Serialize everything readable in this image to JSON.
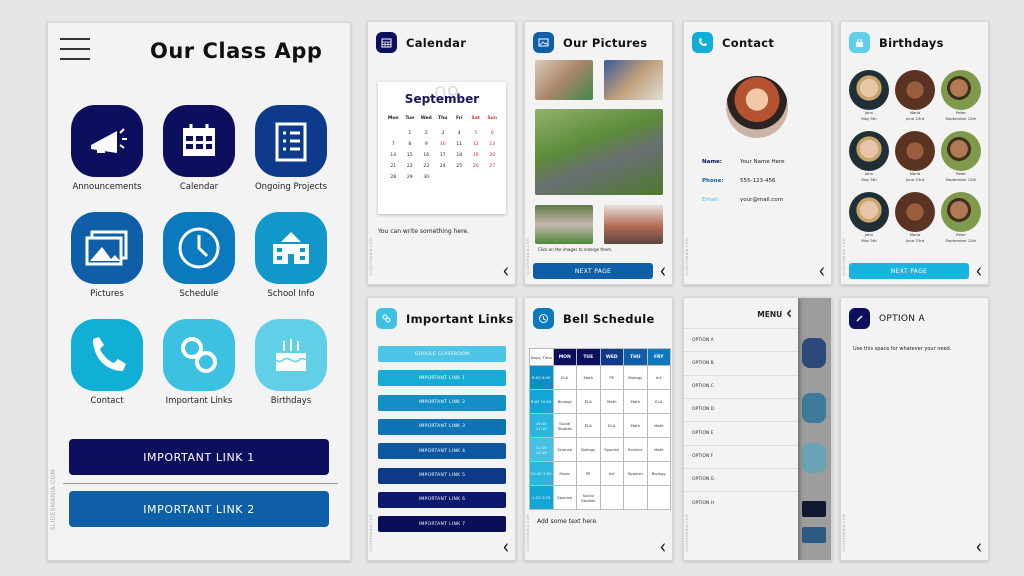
{
  "colors": {
    "navy": "#0c0e5e",
    "dark_blue": "#0d3a8a",
    "blue": "#0f5fa8",
    "mid_blue": "#0b79bd",
    "cyan": "#11aed6",
    "light_cyan": "#3cc1e2",
    "pale_cyan": "#62cfe8",
    "red": "#cc3333"
  },
  "watermark": "SLIDESMANIA.COM",
  "main": {
    "title": "Our Class App",
    "menu_icon": "hamburger-icon",
    "tiles": [
      {
        "label": "Announcements",
        "icon": "megaphone-icon",
        "color": "#0c0e5e"
      },
      {
        "label": "Calendar",
        "icon": "calendar-icon",
        "color": "#0c0e5e"
      },
      {
        "label": "Ongoing Projects",
        "icon": "clipboard-icon",
        "color": "#0d3a8a"
      },
      {
        "label": "Pictures",
        "icon": "pictures-icon",
        "color": "#0f5fa8"
      },
      {
        "label": "Schedule",
        "icon": "clock-icon",
        "color": "#0b79bd"
      },
      {
        "label": "School Info",
        "icon": "school-icon",
        "color": "#1297cb"
      },
      {
        "label": "Contact",
        "icon": "phone-icon",
        "color": "#11aed6"
      },
      {
        "label": "Important Links",
        "icon": "link-icon",
        "color": "#3cc1e2"
      },
      {
        "label": "Birthdays",
        "icon": "cake-icon",
        "color": "#62cfe8"
      }
    ],
    "buttons": [
      "IMPORTANT LINK 1",
      "IMPORTANT LINK 2"
    ]
  },
  "calendar": {
    "title": "Calendar",
    "month": "September",
    "month_number": "09",
    "weekdays": [
      "Mon",
      "Tue",
      "Wed",
      "Thu",
      "Fri",
      "Sat",
      "Sun"
    ],
    "weeks": [
      [
        "",
        "1",
        "2",
        "3",
        "4",
        "5",
        "6"
      ],
      [
        "7",
        "8",
        "9",
        "10",
        "11",
        "12",
        "13"
      ],
      [
        "14",
        "15",
        "16",
        "17",
        "18",
        "19",
        "20"
      ],
      [
        "21",
        "22",
        "23",
        "24",
        "25",
        "26",
        "27"
      ],
      [
        "28",
        "29",
        "30",
        "",
        "",
        "",
        ""
      ]
    ],
    "highlighted_days": [
      "10"
    ],
    "note": "You can write something here."
  },
  "pictures": {
    "title": "Our Pictures",
    "hint": "Click on the images to enlarge them.",
    "next": "NEXT PAGE"
  },
  "contact": {
    "title": "Contact",
    "fields": [
      {
        "label": "Name:",
        "value": "Your Name Here",
        "color": "#0c0e5e"
      },
      {
        "label": "Phone:",
        "value": "555-123-456",
        "color": "#0f5fa8"
      },
      {
        "label": "Email:",
        "value": "your@mail.com",
        "color": "#3cc1e2"
      }
    ]
  },
  "birthdays": {
    "title": "Birthdays",
    "next": "NEXT PAGE",
    "kids": [
      {
        "name": "John",
        "date": "May 5th"
      },
      {
        "name": "Maria",
        "date": "June 23rd"
      },
      {
        "name": "Peter",
        "date": "September 12th"
      },
      {
        "name": "John",
        "date": "May 5th"
      },
      {
        "name": "Maria",
        "date": "June 23rd"
      },
      {
        "name": "Peter",
        "date": "September 12th"
      },
      {
        "name": "John",
        "date": "May 5th"
      },
      {
        "name": "Maria",
        "date": "June 23rd"
      },
      {
        "name": "Peter",
        "date": "September 12th"
      }
    ]
  },
  "links": {
    "title": "Important Links",
    "items": [
      {
        "label": "GOOGLE CLASSROOM",
        "color": "#4ec4e6"
      },
      {
        "label": "IMPORTANT LINK 1",
        "color": "#17acd6"
      },
      {
        "label": "IMPORTANT LINK 2",
        "color": "#1290c6"
      },
      {
        "label": "IMPORTANT LINK 3",
        "color": "#0f74b6"
      },
      {
        "label": "IMPORTANT LINK 4",
        "color": "#0d56a0"
      },
      {
        "label": "IMPORTANT LINK 5",
        "color": "#0c3a88"
      },
      {
        "label": "IMPORTANT LINK 6",
        "color": "#0c1870"
      },
      {
        "label": "IMPORTANT LINK 7",
        "color": "#0a0d5a"
      }
    ]
  },
  "schedule": {
    "title": "Bell Schedule",
    "corner": "Days/ Time",
    "days": [
      {
        "label": "MON",
        "color": "#0c0e5e"
      },
      {
        "label": "TUE",
        "color": "#0c0e5e"
      },
      {
        "label": "WED",
        "color": "#0d3a8a"
      },
      {
        "label": "THU",
        "color": "#0f5fa8"
      },
      {
        "label": "FRY",
        "color": "#0b79bd"
      }
    ],
    "rows": [
      {
        "time": "8:00 9:00",
        "color": "#0b8fc9",
        "classes": [
          "ELA",
          "Math",
          "PE",
          "Biology",
          "Art"
        ]
      },
      {
        "time": "9:05 10:05",
        "color": "#11a6d6",
        "classes": [
          "Biology",
          "ELA",
          "Math",
          "Math",
          "ELA"
        ]
      },
      {
        "time": "10:10 11:10",
        "color": "#2bb6de",
        "classes": [
          "Social Studies",
          "ELA",
          "ELA",
          "Math",
          "Math"
        ]
      },
      {
        "time": "11:15 12:15",
        "color": "#45c1e3",
        "classes": [
          "Science",
          "Biology",
          "Spanish",
          "Science",
          "Math"
        ]
      },
      {
        "time": "12:30 1:20",
        "color": "#2bb6de",
        "classes": [
          "Music",
          "PE",
          "Art",
          "Spanish",
          "Biology"
        ]
      },
      {
        "time": "1:25 2:25",
        "color": "#11a6d6",
        "classes": [
          "Spanish",
          "Social Studies",
          "",
          "",
          ""
        ]
      }
    ],
    "note": "Add some text here."
  },
  "menu": {
    "title": "MENU",
    "options": [
      "OPTION A",
      "OPTION B",
      "OPTION C",
      "OPTION D",
      "OPTION E",
      "OPTION F",
      "OPTION G",
      "OPTION H"
    ]
  },
  "option_a": {
    "title": "OPTION A",
    "text": "Use this space for whatever your need."
  }
}
